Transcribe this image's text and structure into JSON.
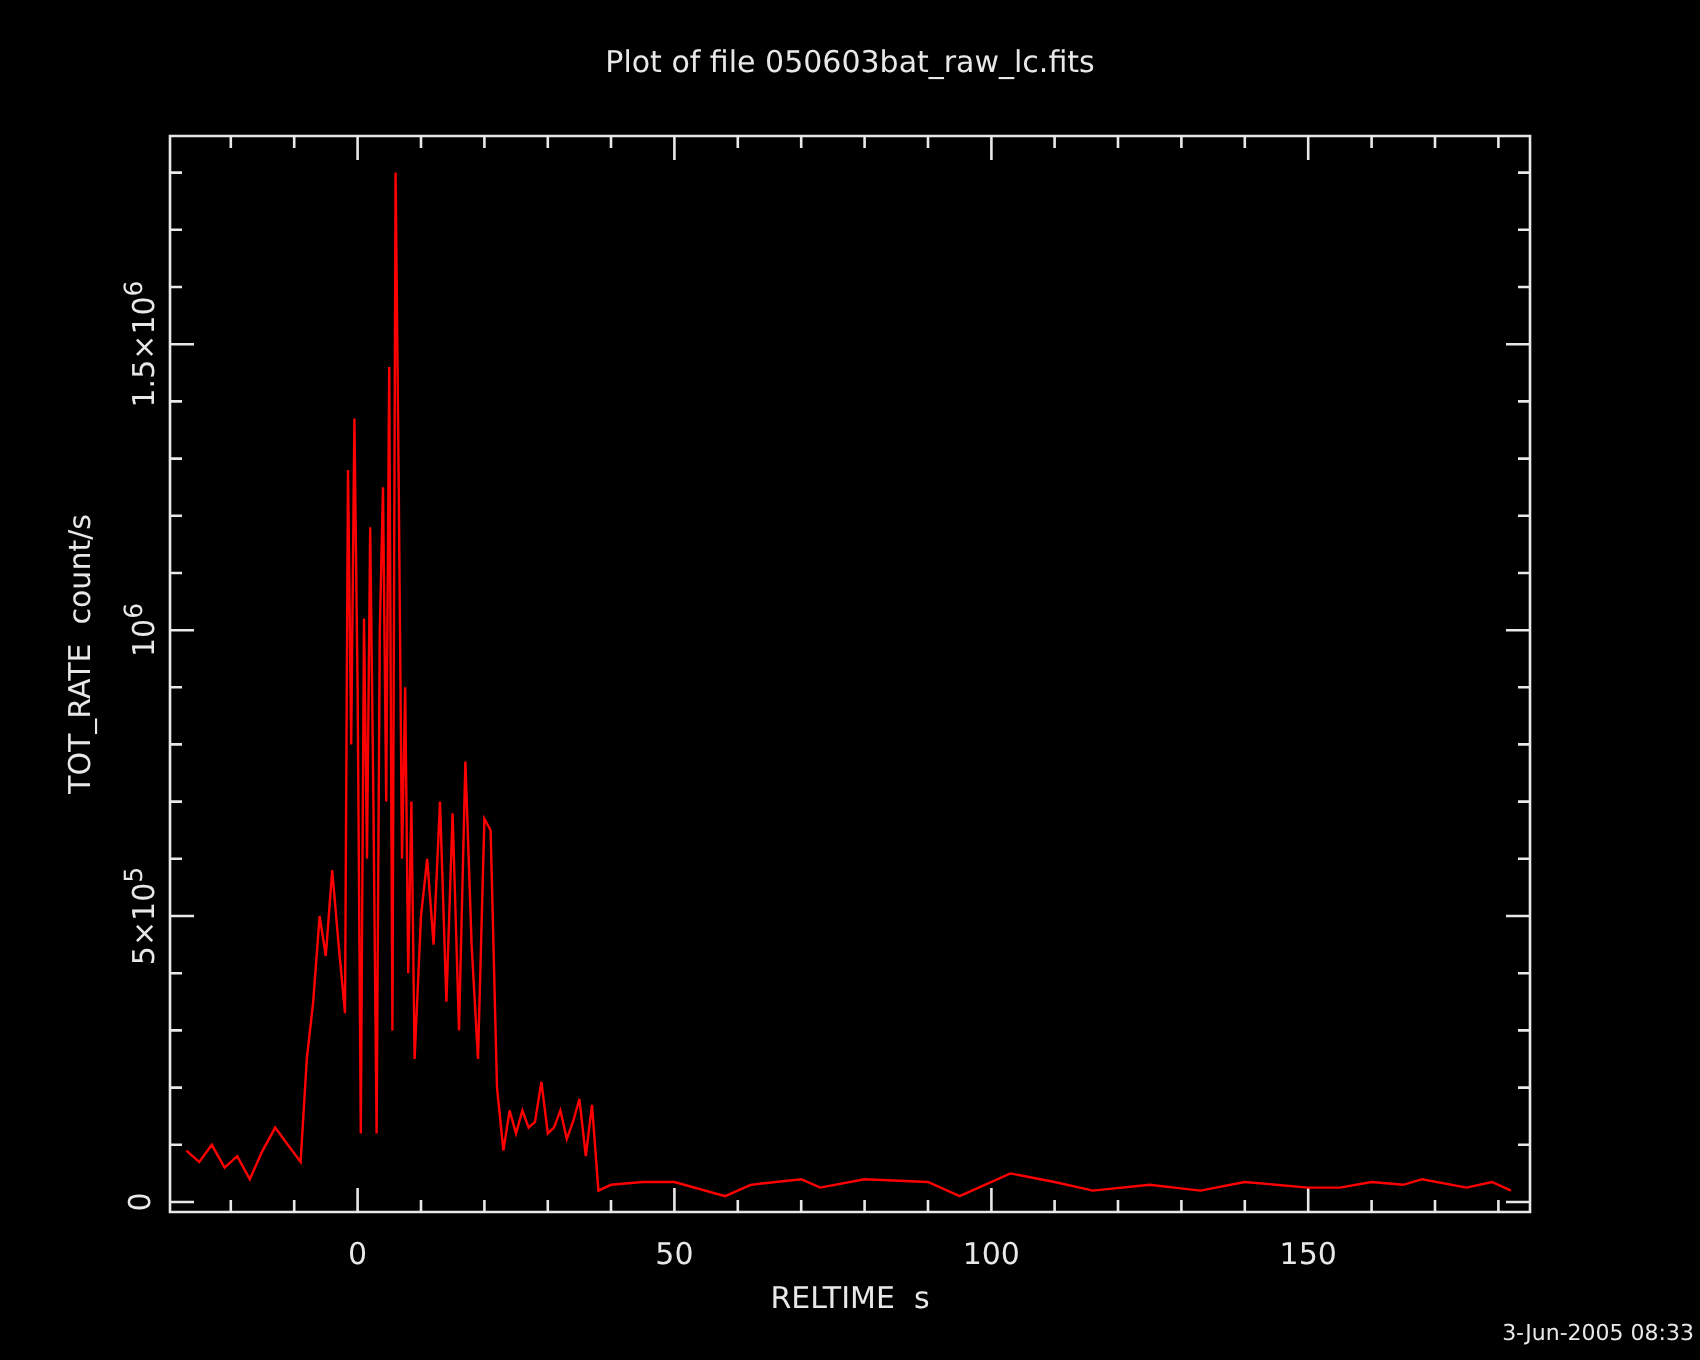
{
  "window": {
    "title": "Plot of file 050603bat_raw_lc.fits"
  },
  "plot": {
    "chart_data": {
      "type": "line",
      "xlabel": "RELTIME  s",
      "ylabel": "TOT_RATE  count/s",
      "xlim": [
        -29.6,
        185
      ],
      "ylim": [
        -17500,
        1864000
      ],
      "xticks": [
        0,
        50,
        100,
        150
      ],
      "yticks": [
        {
          "value": 0,
          "label": "0"
        },
        {
          "value": 500000,
          "label": "5×10$^{5}$"
        },
        {
          "value": 1000000,
          "label": "10$^{6}$"
        },
        {
          "value": 1500000,
          "label": "1.5×10$^{6}$"
        }
      ],
      "x": [
        -27,
        -25,
        -23,
        -21,
        -19,
        -17,
        -15,
        -13,
        -11,
        -9,
        -8,
        -7,
        -6,
        -5,
        -4,
        -3,
        -2,
        -1.5,
        -1,
        -0.5,
        0,
        0.5,
        1,
        1.5,
        2,
        2.5,
        3,
        3.5,
        4,
        4.5,
        5,
        5.5,
        6,
        6.5,
        7,
        7.5,
        8,
        8.5,
        9,
        10,
        11,
        12,
        13,
        14,
        15,
        16,
        17,
        18,
        19,
        20,
        21,
        22,
        23,
        24,
        25,
        26,
        27,
        28,
        29,
        30,
        31,
        32,
        33,
        34,
        35,
        36,
        37,
        38,
        40,
        45,
        50,
        58,
        62,
        70,
        73,
        80,
        90,
        95,
        103,
        110,
        116,
        125,
        133,
        140,
        150,
        155,
        160,
        165,
        168,
        175,
        179,
        182
      ],
      "series": [
        {
          "color": "#ff0000",
          "values": [
            90000,
            70000,
            100000,
            60000,
            80000,
            40000,
            90000,
            130000,
            100000,
            70000,
            250000,
            350000,
            500000,
            430000,
            580000,
            450000,
            330000,
            1280000,
            800000,
            1370000,
            900000,
            120000,
            1020000,
            600000,
            1180000,
            700000,
            120000,
            1000000,
            1250000,
            700000,
            1460000,
            300000,
            1800000,
            1240000,
            600000,
            900000,
            400000,
            700000,
            250000,
            500000,
            600000,
            450000,
            700000,
            350000,
            680000,
            300000,
            770000,
            450000,
            250000,
            670000,
            650000,
            200000,
            90000,
            160000,
            120000,
            160000,
            130000,
            140000,
            210000,
            120000,
            130000,
            160000,
            110000,
            140000,
            180000,
            80000,
            170000,
            20000,
            30000,
            35000,
            35000,
            10000,
            30000,
            40000,
            25000,
            40000,
            35000,
            10000,
            50000,
            35000,
            20000,
            30000,
            20000,
            35000,
            25000,
            25000,
            35000,
            30000,
            40000,
            25000,
            35000,
            20000
          ]
        }
      ]
    }
  },
  "timestamp": "3-Jun-2005 08:33"
}
